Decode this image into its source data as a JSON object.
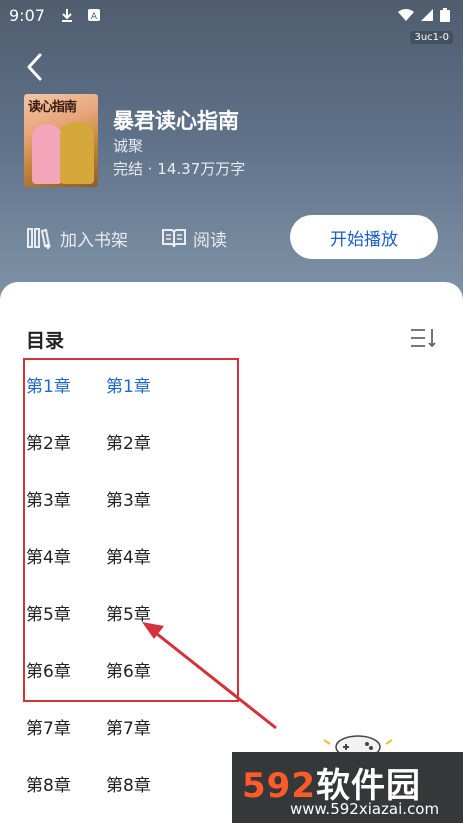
{
  "status_bar": {
    "time": "9:07",
    "badge": "3uc1-0"
  },
  "book": {
    "cover_title": "读心指南",
    "title": "暴君读心指南",
    "author": "诚聚",
    "meta": "完结 · 14.37万万字"
  },
  "actions": {
    "add_shelf": "加入书架",
    "read": "阅读",
    "play": "开始播放"
  },
  "toc": {
    "title": "目录",
    "rows": [
      {
        "c1": "第1章",
        "c2": "第1章"
      },
      {
        "c1": "第2章",
        "c2": "第2章"
      },
      {
        "c1": "第3章",
        "c2": "第3章"
      },
      {
        "c1": "第4章",
        "c2": "第4章"
      },
      {
        "c1": "第5章",
        "c2": "第5章"
      },
      {
        "c1": "第6章",
        "c2": "第6章"
      },
      {
        "c1": "第7章",
        "c2": "第7章"
      },
      {
        "c1": "第8章",
        "c2": "第8章"
      }
    ]
  },
  "watermark": {
    "logo_num": "592",
    "logo_text": "软件园",
    "url": "www.592xiazai.com"
  },
  "colors": {
    "accent": "#2266c8",
    "annotation": "#d6303a"
  }
}
